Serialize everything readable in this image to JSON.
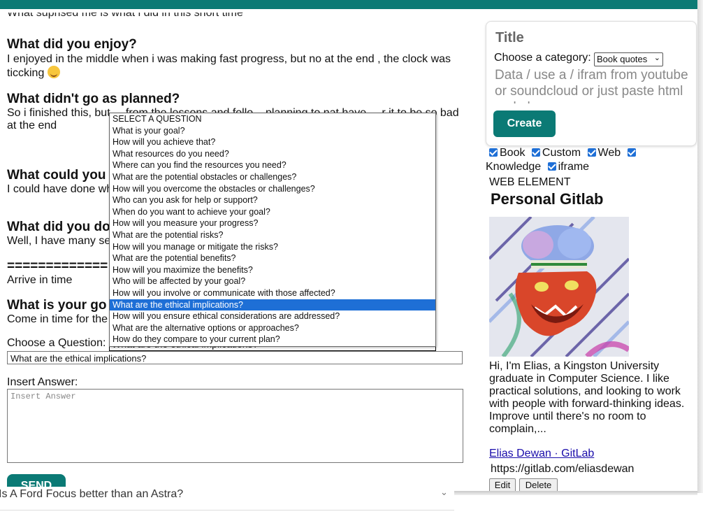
{
  "left": {
    "cut_line": "What suprised me is what i did in this short time",
    "sections": [
      {
        "heading": "What did you enjoy?",
        "text": "I enjoyed in the middle when i was making fast progress, but no at the end , the clock was ticcking"
      },
      {
        "heading": "What didn't go as planned?",
        "text": "So i finished this, but ... from the lessons and follo... planning to nat have ... r it to be so bad at the end"
      },
      {
        "heading": "What could you",
        "text": "I could have done wh... o earlyer whhen there"
      },
      {
        "heading": "What did you do",
        "text": "Well, I have many se"
      },
      {
        "heading": "=============",
        "text": "Arrive in time"
      },
      {
        "heading": "What is your go",
        "text": "Come in time for the"
      }
    ],
    "choose_label": "Choose a Question:",
    "selected_question": "What are the ethical implications?",
    "question_input_value": "What are the ethical implications?",
    "answer_label": "Insert Answer:",
    "answer_placeholder": "Insert Answer",
    "send_label": "SEND",
    "behind_text": "Is A Ford Focus better than an Astra?"
  },
  "dropdown": {
    "options": [
      "SELECT A QUESTION",
      "What is your goal?",
      "How will you achieve that?",
      "What resources do you need?",
      "Where can you find the resources you need?",
      "What are the potential obstacles or challenges?",
      "How will you overcome the obstacles or challenges?",
      "Who can you ask for help or support?",
      "When do you want to achieve your goal?",
      "How will you measure your progress?",
      "What are the potential risks?",
      "How will you manage or mitigate the risks?",
      "What are the potential benefits?",
      "How will you maximize the benefits?",
      "Who will be affected by your goal?",
      "How will you involve or communicate with those affected?",
      "What are the ethical implications?",
      "How will you ensure ethical considerations are addressed?",
      "What are the alternative options or approaches?",
      "How do they compare to your current plan?"
    ],
    "selected_index": 16
  },
  "card": {
    "title": "Title",
    "category_label": "Choose a category:",
    "category_value": "Book quotes",
    "data_placeholder": "Data / use a / ifram from youtube or soundcloud or just paste html code here",
    "create_label": "Create"
  },
  "filters": [
    {
      "label": "Book",
      "checked": true
    },
    {
      "label": "Custom",
      "checked": true
    },
    {
      "label": "Web",
      "checked": true
    },
    {
      "label": "Knowledge",
      "checked": true
    },
    {
      "label": "iframe",
      "checked": true
    }
  ],
  "web_element": {
    "type_label": "WEB ELEMENT",
    "name": "Personal Gitlab",
    "description": "Hi, I'm Elias, a Kingston University graduate in Computer Science. I like practical solutions, and looking to work with people with forward-thinking ideas. Improve until there's no room to complain,...",
    "link_text": "Elias Dewan · GitLab",
    "url": "https://gitlab.com/eliasdewan",
    "edit_label": "Edit",
    "delete_label": "Delete"
  },
  "colors": {
    "accent": "#0b7a75",
    "selection": "#1e6fd6"
  }
}
